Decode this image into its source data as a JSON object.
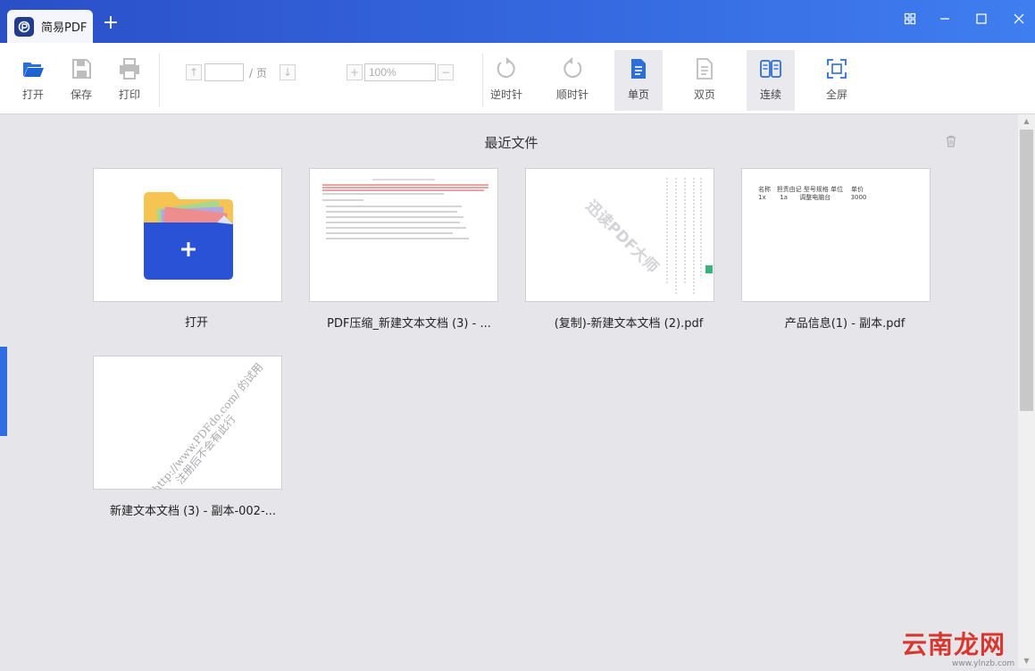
{
  "window": {
    "tab_title": "简易PDF",
    "new_tab": "+"
  },
  "toolbar": {
    "open": "打开",
    "save": "保存",
    "print": "打印",
    "page_value": "",
    "page_suffix": "/ 页",
    "zoom_value": "100%",
    "rotate_ccw": "逆时针",
    "rotate_cw": "顺时针",
    "single_page": "单页",
    "double_page": "双页",
    "continuous": "连续",
    "fullscreen": "全屏"
  },
  "main": {
    "title": "最近文件",
    "cards": [
      {
        "label": "打开",
        "type": "open"
      },
      {
        "label": "PDF压缩_新建文本文档 (3) - ..."
      },
      {
        "label": "(复制)-新建文本文档 (2).pdf",
        "thumb_watermark": "迅读PDF大师"
      },
      {
        "label": "产品信息(1) - 副本.pdf",
        "thumb_headers": [
          "名称",
          "担责由记 型号规格 单位",
          "单价"
        ],
        "thumb_row": [
          "1x",
          "1a",
          "调整电脑台",
          "3000"
        ]
      },
      {
        "label": "新建文本文档 (3) - 副本-002-...",
        "thumb_watermark": "http://www.PDFdo.com/ 的试用版，注册后不会有此行"
      }
    ]
  },
  "watermark": {
    "brand": "云南龙网",
    "url": "www.ylnzb.com"
  },
  "colors": {
    "titlebar": "#3568e0",
    "accent": "#2f6de0",
    "folder_blue": "#2a52d6",
    "folder_yellow": "#f6c453"
  }
}
